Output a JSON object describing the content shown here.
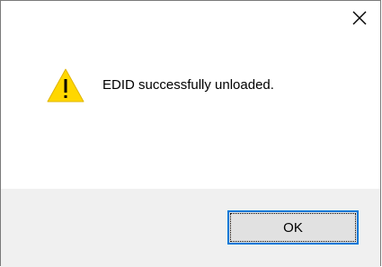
{
  "dialog": {
    "message": "EDID successfully unloaded.",
    "ok_label": "OK",
    "icon": "warning-icon",
    "close_icon": "close-icon",
    "colors": {
      "accent": "#0078d7",
      "warning": "#ffd700",
      "footer_bg": "#f0f0f0"
    }
  }
}
